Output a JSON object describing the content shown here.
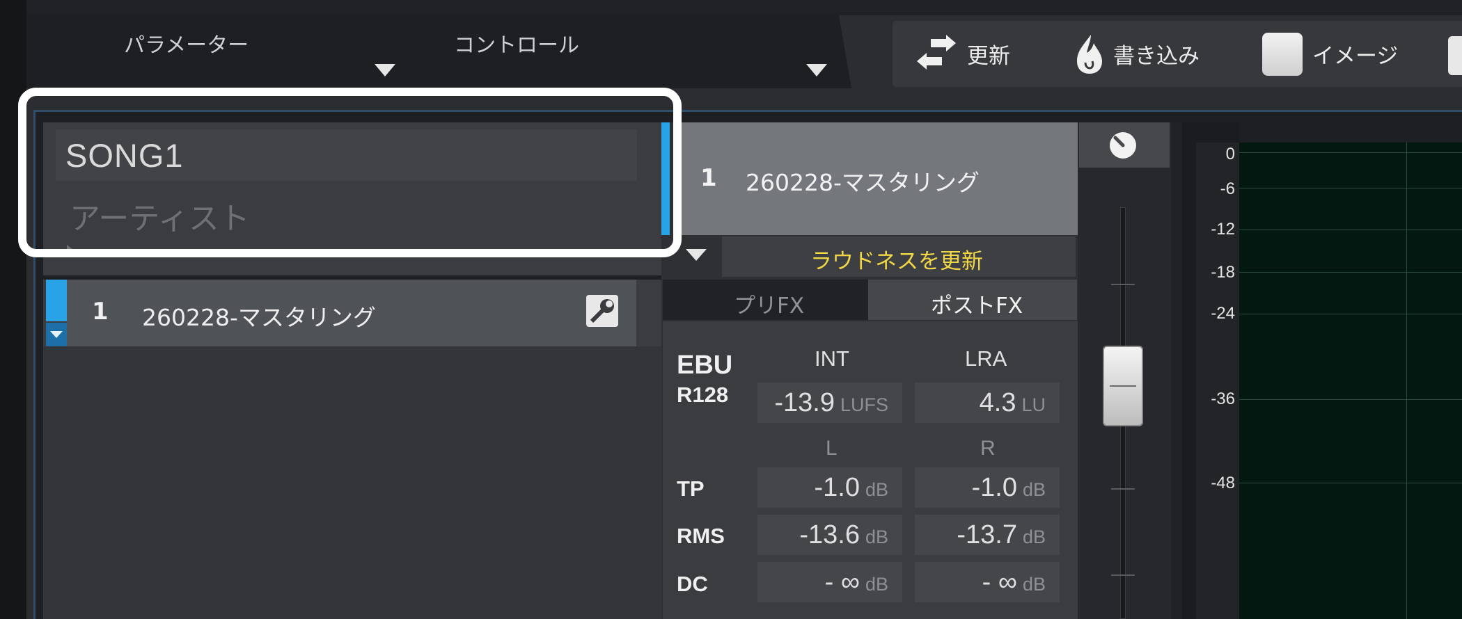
{
  "header": {
    "parameter_label": "パラメーター",
    "control_label": "コントロール"
  },
  "toolbar": {
    "refresh_label": "更新",
    "write_label": "書き込み",
    "image_label": "イメージ"
  },
  "song": {
    "title": "SONG1",
    "artist_placeholder": "アーティスト"
  },
  "track_list": [
    {
      "number": "1",
      "name": "260228-マスタリング"
    }
  ],
  "selected_track": {
    "number": "1",
    "name": "260228-マスタリング"
  },
  "loudness": {
    "update_label": "ラウドネスを更新",
    "tabs": {
      "pre_fx": "プリFX",
      "post_fx": "ポストFX"
    },
    "standard": {
      "line1": "EBU",
      "line2": "R128"
    },
    "int_header": "INT",
    "lra_header": "LRA",
    "int_value": "-13.9",
    "int_unit": "LUFS",
    "lra_value": "4.3",
    "lra_unit": "LU",
    "l_header": "L",
    "r_header": "R",
    "rows": [
      {
        "label": "TP",
        "l_value": "-1.0",
        "l_unit": "dB",
        "r_value": "-1.0",
        "r_unit": "dB"
      },
      {
        "label": "RMS",
        "l_value": "-13.6",
        "l_unit": "dB",
        "r_value": "-13.7",
        "r_unit": "dB"
      },
      {
        "label": "DC",
        "l_value": "- ∞",
        "l_unit": "dB",
        "r_value": "- ∞",
        "r_unit": "dB"
      }
    ]
  },
  "scale": [
    "0",
    "-6",
    "-12",
    "-18",
    "-24",
    "-36",
    "-48"
  ],
  "colors": {
    "accent_blue": "#29a3e8",
    "update_text": "#f1d646",
    "spectrum_bg": "#041812"
  }
}
